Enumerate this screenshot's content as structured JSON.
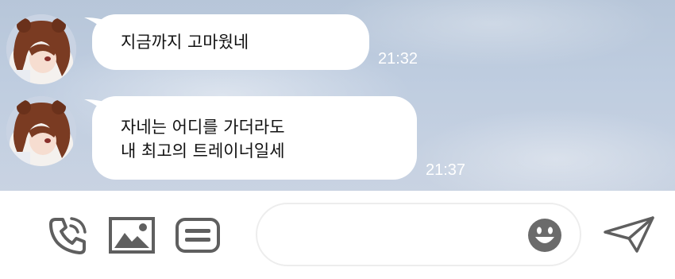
{
  "messages": [
    {
      "lines": [
        "지금까지 고마웠네"
      ],
      "time": "21:32"
    },
    {
      "lines": [
        "자네는 어디를 가더라도",
        "내 최고의 트레이너일세"
      ],
      "time": "21:37"
    }
  ],
  "composer": {
    "placeholder": ""
  },
  "icons": {
    "call": "phone-icon",
    "image": "image-icon",
    "template": "message-template-icon",
    "emoji": "emoji-icon",
    "send": "send-icon"
  },
  "colors": {
    "icon": "#5f5f5f",
    "bubble": "#ffffff",
    "timestamp": "#ffffff"
  }
}
